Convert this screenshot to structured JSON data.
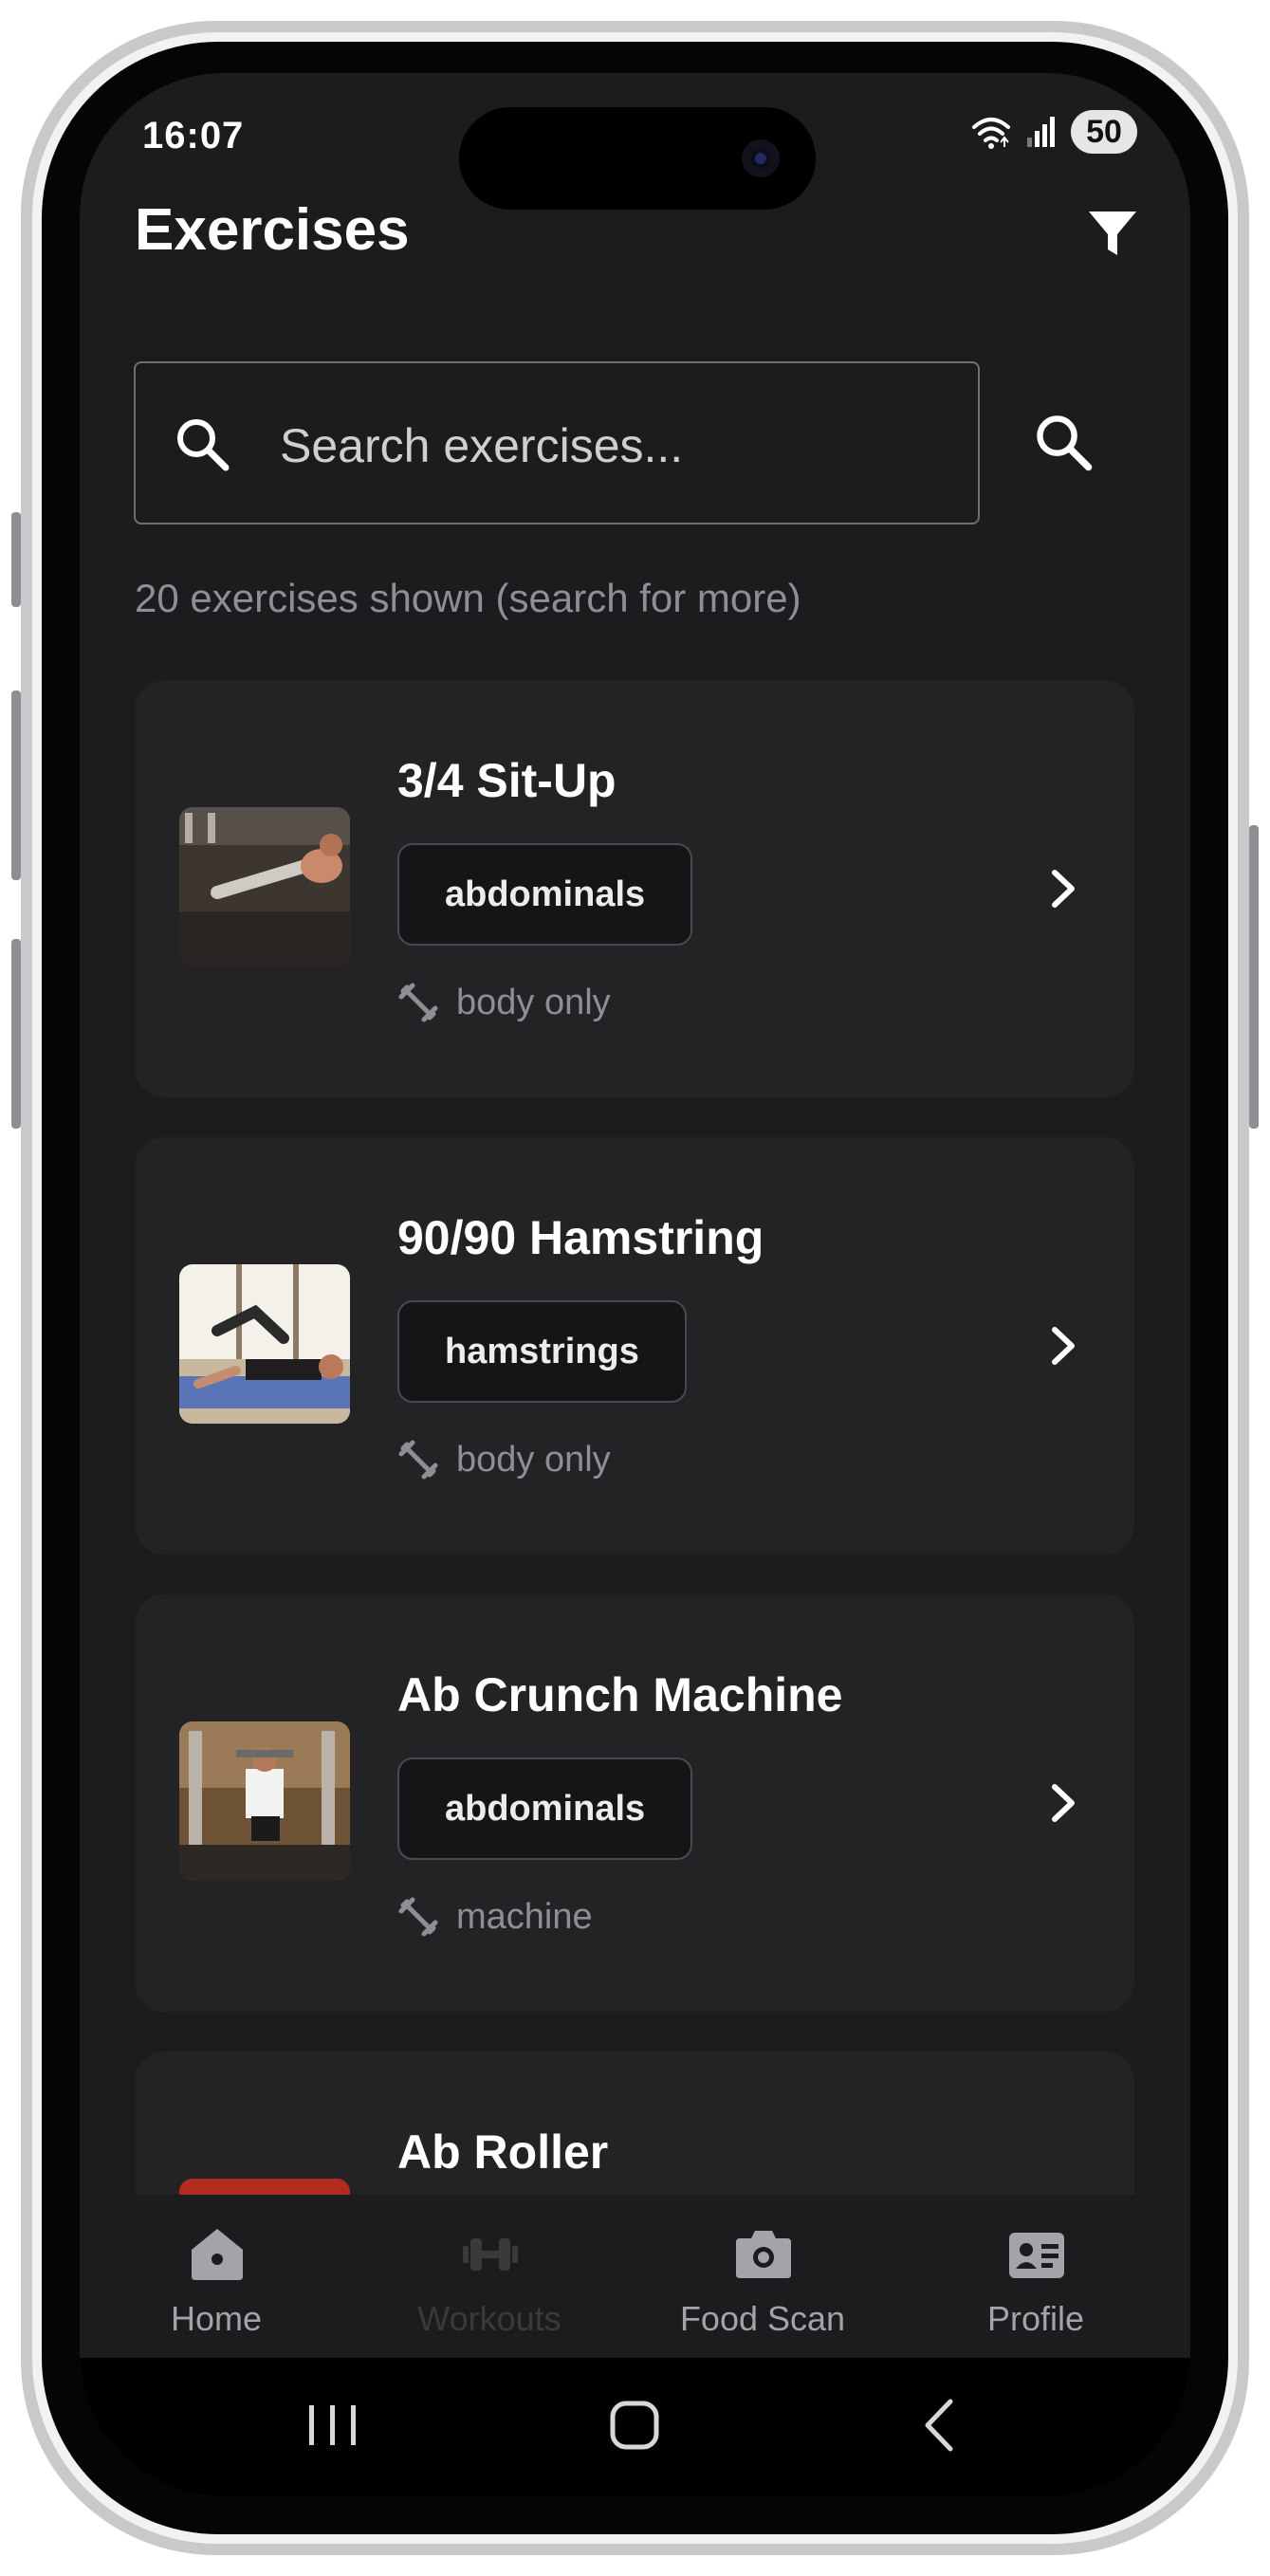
{
  "status_bar": {
    "time": "16:07",
    "battery": "50"
  },
  "header": {
    "title": "Exercises"
  },
  "search": {
    "placeholder": "Search exercises..."
  },
  "results": {
    "count_text": "20 exercises shown (search for more)"
  },
  "exercises": [
    {
      "name": "3/4 Sit-Up",
      "muscle": "abdominals",
      "equipment": "body only"
    },
    {
      "name": "90/90 Hamstring",
      "muscle": "hamstrings",
      "equipment": "body only"
    },
    {
      "name": "Ab Crunch Machine",
      "muscle": "abdominals",
      "equipment": "machine"
    },
    {
      "name": "Ab Roller",
      "muscle": "",
      "equipment": ""
    }
  ],
  "bottom_nav": [
    {
      "label": "Home",
      "icon": "home-icon",
      "active": false
    },
    {
      "label": "Workouts",
      "icon": "dumbbell-icon",
      "active": true
    },
    {
      "label": "Food Scan",
      "icon": "camera-icon",
      "active": false
    },
    {
      "label": "Profile",
      "icon": "id-card-icon",
      "active": false
    }
  ],
  "colors": {
    "background": "#1c1c1e",
    "card": "#232326",
    "tag_background": "#151517",
    "text_primary": "#ffffff",
    "text_secondary": "#8e8e93"
  }
}
